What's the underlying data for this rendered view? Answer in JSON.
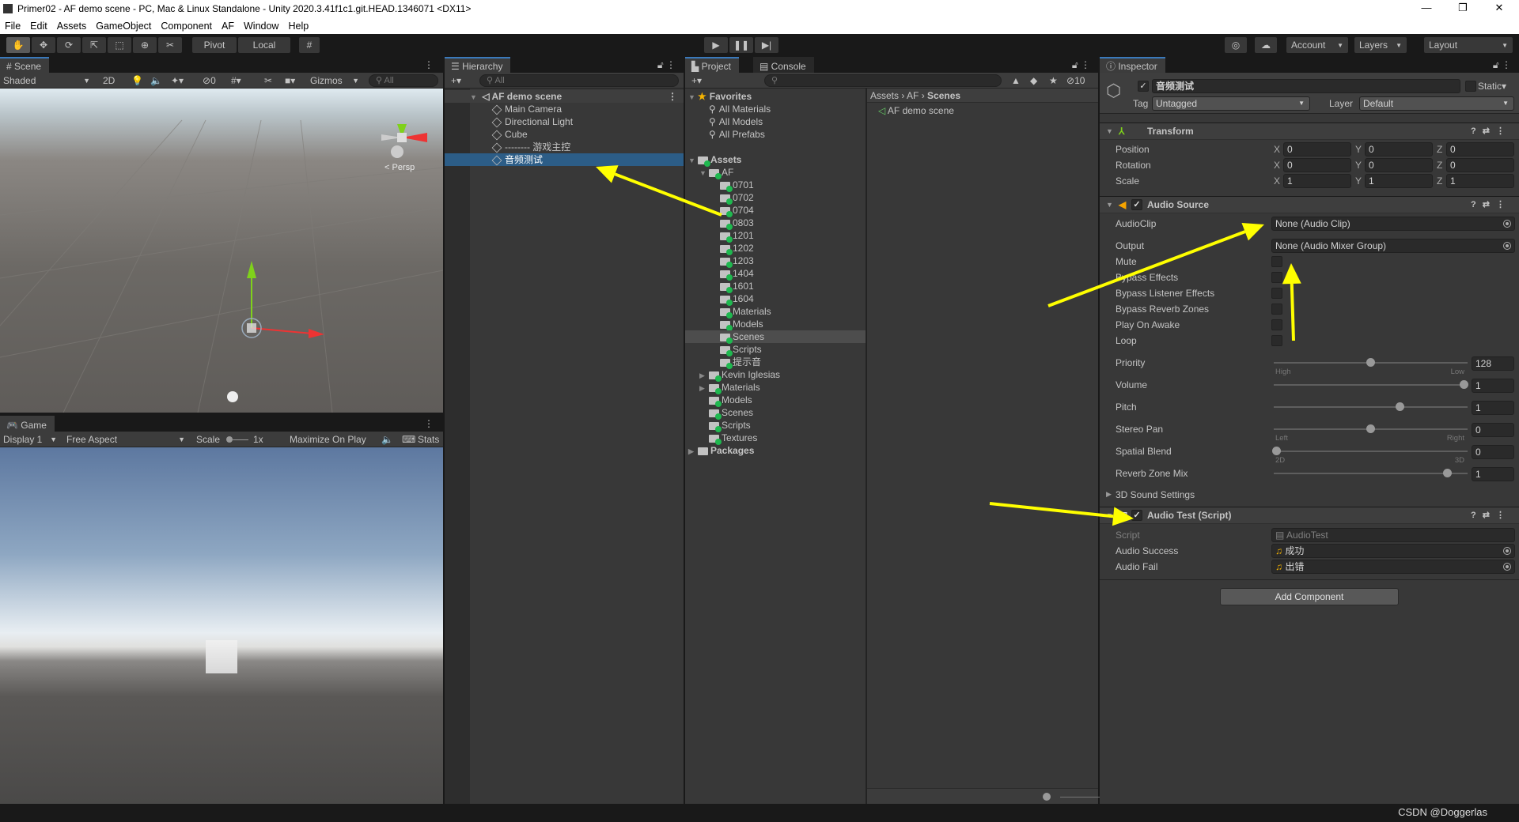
{
  "window": {
    "title": "Primer02 - AF demo scene - PC, Mac & Linux Standalone - Unity 2020.3.41f1c1.git.HEAD.1346071 <DX11>",
    "minimize": "—",
    "maximize": "❐",
    "close": "✕"
  },
  "menu": [
    "File",
    "Edit",
    "Assets",
    "GameObject",
    "Component",
    "AF",
    "Window",
    "Help"
  ],
  "toolbar": {
    "pivot": "Pivot",
    "local": "Local",
    "account": "Account",
    "layers": "Layers",
    "layout": "Layout"
  },
  "scene": {
    "tab": "Scene",
    "shading": "Shaded",
    "mode2d": "2D",
    "hidden_count": "0",
    "gizmos": "Gizmos",
    "search_placeholder": "All",
    "persp": "Persp"
  },
  "game": {
    "tab": "Game",
    "display": "Display 1",
    "aspect": "Free Aspect",
    "scale_label": "Scale",
    "scale_value": "1x",
    "maximize": "Maximize On Play",
    "stats": "Stats"
  },
  "hierarchy": {
    "tab": "Hierarchy",
    "search_placeholder": "All",
    "scene": "AF demo scene",
    "items": [
      {
        "label": "Main Camera",
        "selected": false
      },
      {
        "label": "Directional Light",
        "selected": false
      },
      {
        "label": "Cube",
        "selected": false
      },
      {
        "label": "-------- 游戏主控",
        "selected": false
      },
      {
        "label": "音频测试",
        "selected": true
      }
    ]
  },
  "project": {
    "tab": "Project",
    "console_tab": "Console",
    "hidden_count": "10",
    "breadcrumb": [
      "Assets",
      "AF",
      "Scenes"
    ],
    "files": [
      "AF demo scene"
    ],
    "tree": [
      {
        "label": "Favorites",
        "depth": 0,
        "type": "star",
        "expanded": true,
        "bold": true
      },
      {
        "label": "All Materials",
        "depth": 1,
        "type": "search"
      },
      {
        "label": "All Models",
        "depth": 1,
        "type": "search"
      },
      {
        "label": "All Prefabs",
        "depth": 1,
        "type": "search"
      },
      {
        "label": "",
        "depth": 0,
        "type": "spacer"
      },
      {
        "label": "Assets",
        "depth": 0,
        "type": "folder",
        "expanded": true,
        "bold": true
      },
      {
        "label": "AF",
        "depth": 1,
        "type": "folder",
        "expanded": true
      },
      {
        "label": "0701",
        "depth": 2,
        "type": "folder"
      },
      {
        "label": "0702",
        "depth": 2,
        "type": "folder"
      },
      {
        "label": "0704",
        "depth": 2,
        "type": "folder"
      },
      {
        "label": "0803",
        "depth": 2,
        "type": "folder"
      },
      {
        "label": "1201",
        "depth": 2,
        "type": "folder"
      },
      {
        "label": "1202",
        "depth": 2,
        "type": "folder"
      },
      {
        "label": "1203",
        "depth": 2,
        "type": "folder"
      },
      {
        "label": "1404",
        "depth": 2,
        "type": "folder"
      },
      {
        "label": "1601",
        "depth": 2,
        "type": "folder"
      },
      {
        "label": "1604",
        "depth": 2,
        "type": "folder"
      },
      {
        "label": "Materials",
        "depth": 2,
        "type": "folder"
      },
      {
        "label": "Models",
        "depth": 2,
        "type": "folder"
      },
      {
        "label": "Scenes",
        "depth": 2,
        "type": "folder",
        "highlighted": true
      },
      {
        "label": "Scripts",
        "depth": 2,
        "type": "folder"
      },
      {
        "label": "提示音",
        "depth": 2,
        "type": "folder"
      },
      {
        "label": "Kevin Iglesias",
        "depth": 1,
        "type": "folder",
        "collapsed": true
      },
      {
        "label": "Materials",
        "depth": 1,
        "type": "folder",
        "collapsed": true
      },
      {
        "label": "Models",
        "depth": 1,
        "type": "folder"
      },
      {
        "label": "Scenes",
        "depth": 1,
        "type": "folder"
      },
      {
        "label": "Scripts",
        "depth": 1,
        "type": "folder"
      },
      {
        "label": "Textures",
        "depth": 1,
        "type": "folder"
      },
      {
        "label": "Packages",
        "depth": 0,
        "type": "folder",
        "collapsed": true,
        "bold": true
      }
    ]
  },
  "inspector": {
    "tab": "Inspector",
    "object_name": "音频测试",
    "active": true,
    "static": "Static",
    "tag_label": "Tag",
    "tag": "Untagged",
    "layer_label": "Layer",
    "layer": "Default",
    "transform": {
      "title": "Transform",
      "rows": [
        {
          "label": "Position",
          "x": "0",
          "y": "0",
          "z": "0"
        },
        {
          "label": "Rotation",
          "x": "0",
          "y": "0",
          "z": "0"
        },
        {
          "label": "Scale",
          "x": "1",
          "y": "1",
          "z": "1"
        }
      ]
    },
    "audio_source": {
      "title": "Audio Source",
      "enabled": true,
      "audioclip_label": "AudioClip",
      "audioclip": "None (Audio Clip)",
      "output_label": "Output",
      "output": "None (Audio Mixer Group)",
      "toggles": [
        {
          "label": "Mute",
          "checked": false
        },
        {
          "label": "Bypass Effects",
          "checked": false
        },
        {
          "label": "Bypass Listener Effects",
          "checked": false
        },
        {
          "label": "Bypass Reverb Zones",
          "checked": false
        },
        {
          "label": "Play On Awake",
          "checked": false
        },
        {
          "label": "Loop",
          "checked": false
        }
      ],
      "sliders": [
        {
          "label": "Priority",
          "value": "128",
          "fraction": 0.5,
          "min_label": "High",
          "max_label": "Low"
        },
        {
          "label": "Volume",
          "value": "1",
          "fraction": 1.0
        },
        {
          "label": "Pitch",
          "value": "1",
          "fraction": 0.66
        },
        {
          "label": "Stereo Pan",
          "value": "0",
          "fraction": 0.5,
          "min_label": "Left",
          "max_label": "Right"
        },
        {
          "label": "Spatial Blend",
          "value": "0",
          "fraction": 0.0,
          "min_label": "2D",
          "max_label": "3D"
        },
        {
          "label": "Reverb Zone Mix",
          "value": "1",
          "fraction": 0.91
        }
      ],
      "sound_settings": "3D Sound Settings"
    },
    "audio_test": {
      "title": "Audio Test (Script)",
      "enabled": true,
      "script_label": "Script",
      "script": "AudioTest",
      "success_label": "Audio Success",
      "success": "成功",
      "fail_label": "Audio Fail",
      "fail": "出错"
    },
    "add_component": "Add Component"
  },
  "annotation_color": "#ffff00",
  "watermark": "CSDN @Doggerlas"
}
